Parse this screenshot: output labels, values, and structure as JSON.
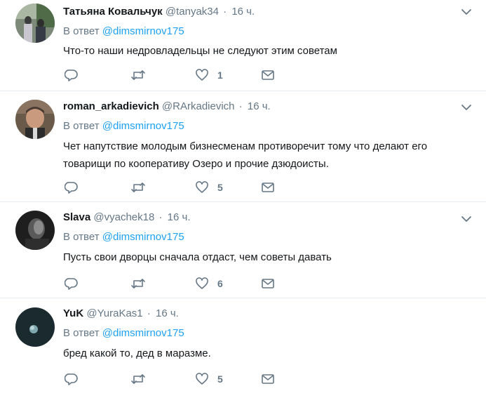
{
  "tweets": [
    {
      "name": "Татьяна Ковальчук",
      "handle": "@tanyak34",
      "time": "16 ч.",
      "reply_prefix": "В ответ",
      "reply_to": "@dimsmirnov175",
      "text": "Что-то наши недровладельцы не следуют этим советам",
      "likes": "1"
    },
    {
      "name": "roman_arkadievich",
      "handle": "@RArkadievich",
      "time": "16 ч.",
      "reply_prefix": "В ответ",
      "reply_to": "@dimsmirnov175",
      "text": "Чет напутствие молодым бизнесменам противоречит тому что делают его товарищи по кооперативу Озеро и прочие дзюдоисты.",
      "likes": "5"
    },
    {
      "name": "Slava",
      "handle": "@vyachek18",
      "time": "16 ч.",
      "reply_prefix": "В ответ",
      "reply_to": "@dimsmirnov175",
      "text": "Пусть свои дворцы сначала отдаст, чем советы давать",
      "likes": "6"
    },
    {
      "name": "YuK",
      "handle": "@YuraKas1",
      "time": "16 ч.",
      "reply_prefix": "В ответ",
      "reply_to": "@dimsmirnov175",
      "text": "бред какой то, дед в маразме.",
      "likes": "5"
    }
  ],
  "colors": {
    "name": "#14171a",
    "secondary": "#657786",
    "link": "#1da1f2",
    "divider": "#e6ecf0"
  },
  "icons": [
    "chevron-down-icon",
    "reply-icon",
    "retweet-icon",
    "like-icon",
    "message-icon"
  ]
}
